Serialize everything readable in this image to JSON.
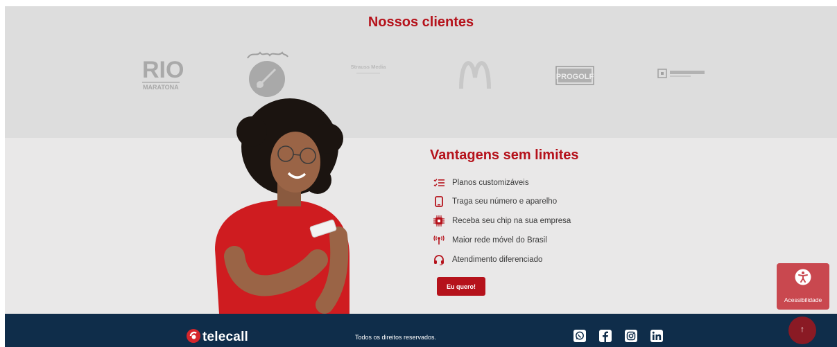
{
  "clients": {
    "title": "Nossos clientes",
    "logos": [
      {
        "name": "Rio Maratona",
        "text_lines": [
          "RIO",
          "MARATONA"
        ]
      },
      {
        "name": "Rock in Rio"
      },
      {
        "name": "Strauss Media",
        "text": "Strauss Media"
      },
      {
        "name": "McDonald's"
      },
      {
        "name": "ProGolf",
        "text": "PROGOLF"
      },
      {
        "name": "sixth-client-logo"
      }
    ]
  },
  "vantagens": {
    "title": "Vantagens sem limites",
    "items": [
      {
        "label": "Planos customizáveis",
        "icon": "checklist-icon"
      },
      {
        "label": "Traga seu número e aparelho",
        "icon": "phone-icon"
      },
      {
        "label": "Receba seu chip na sua empresa",
        "icon": "chip-icon"
      },
      {
        "label": "Maior rede móvel do Brasil",
        "icon": "antenna-icon"
      },
      {
        "label": "Atendimento diferenciado",
        "icon": "headset-icon"
      }
    ],
    "cta_label": "Eu quero!"
  },
  "footer": {
    "brand": "telecall",
    "rights": "Todos os direitos reservados.",
    "social": [
      "whatsapp-icon",
      "facebook-icon",
      "instagram-icon",
      "linkedin-icon"
    ]
  },
  "accessibility": {
    "label": "Acessibilidade"
  },
  "scroll_top": {
    "symbol": "↑"
  },
  "colors": {
    "accent": "#b5121b",
    "footer_bg": "#0f2d4a",
    "clients_bg": "#dddddd",
    "vantagens_bg": "#e9e8e8",
    "accessibility_bg": "#c9484f"
  }
}
